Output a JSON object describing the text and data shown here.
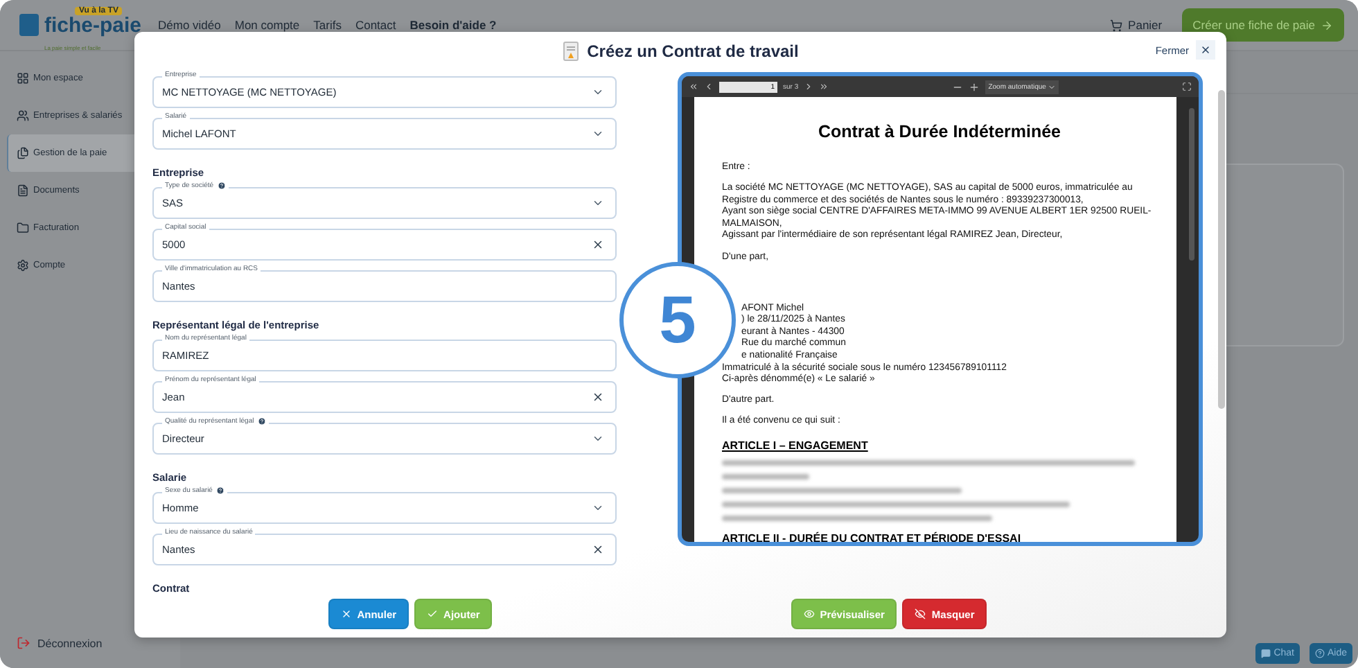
{
  "header": {
    "logo": "fiche-paie",
    "logo_badge": "Vu à la TV",
    "tagline": "La paie simple et facile",
    "nav": [
      {
        "label": "Démo vidéo",
        "bold": false
      },
      {
        "label": "Mon compte",
        "bold": false
      },
      {
        "label": "Tarifs",
        "bold": false
      },
      {
        "label": "Contact",
        "bold": false
      },
      {
        "label": "Besoin d'aide ?",
        "bold": true
      }
    ],
    "cart": "Panier",
    "cta": "Créer une fiche de paie"
  },
  "sidebar": {
    "items": [
      {
        "label": "Mon espace",
        "selected": false
      },
      {
        "label": "Entreprises & salariés",
        "selected": false
      },
      {
        "label": "Gestion de la paie",
        "selected": true
      },
      {
        "label": "Documents",
        "selected": false
      },
      {
        "label": "Facturation",
        "selected": false
      },
      {
        "label": "Compte",
        "selected": false
      }
    ],
    "logout": "Déconnexion"
  },
  "modal": {
    "title": "Créez un Contrat de travail",
    "close": "Fermer",
    "form": [
      {
        "kind": "select",
        "label": "Entreprise",
        "value": "MC NETTOYAGE (MC NETTOYAGE)",
        "help": false
      },
      {
        "kind": "select",
        "label": "Salarié",
        "value": "Michel LAFONT",
        "help": false
      },
      {
        "kind": "section",
        "title": "Entreprise"
      },
      {
        "kind": "select",
        "label": "Type de société",
        "value": "SAS",
        "help": true
      },
      {
        "kind": "clearable",
        "label": "Capital social",
        "value": "5000",
        "help": false
      },
      {
        "kind": "text",
        "label": "Ville d'immatriculation au RCS",
        "value": "Nantes",
        "help": false
      },
      {
        "kind": "section",
        "title": "Représentant légal de l'entreprise"
      },
      {
        "kind": "text",
        "label": "Nom du représentant légal",
        "value": "RAMIREZ",
        "help": false
      },
      {
        "kind": "clearable",
        "label": "Prénom du représentant légal",
        "value": "Jean",
        "help": false
      },
      {
        "kind": "select",
        "label": "Qualité du représentant légal",
        "value": "Directeur",
        "help": true
      },
      {
        "kind": "section",
        "title": "Salarie"
      },
      {
        "kind": "select",
        "label": "Sexe du salarié",
        "value": "Homme",
        "help": true
      },
      {
        "kind": "clearable",
        "label": "Lieu de naissance du salarié",
        "value": "Nantes",
        "help": false
      },
      {
        "kind": "section",
        "title": "Contrat"
      }
    ],
    "pdf": {
      "page": "1",
      "pages": "sur 3",
      "zoom": "Zoom automatique",
      "title": "Contrat à Durée Indéterminée",
      "blocks": [
        {
          "kind": "para",
          "lines": [
            "Entre :"
          ]
        },
        {
          "kind": "para",
          "lines": [
            "La société MC NETTOYAGE (MC NETTOYAGE), SAS au capital de 5000 euros, immatriculée au",
            "Registre du commerce et des sociétés de Nantes sous le numéro : 89339237300013,",
            "Ayant son siège social CENTRE D'AFFAIRES META-IMMO 99 AVENUE ALBERT 1ER 92500 RUEIL-",
            "MALMAISON,",
            "Agissant par l'intermédiaire de son représentant légal RAMIREZ Jean, Directeur,"
          ]
        },
        {
          "kind": "para",
          "lines": [
            "D'une part,"
          ]
        },
        {
          "kind": "covered",
          "lines": [
            "AFONT Michel",
            ") le 28/11/2025 à Nantes",
            "eurant à Nantes - 44300",
            "Rue du marché commun",
            "e nationalité Française"
          ]
        },
        {
          "kind": "tight",
          "lines": [
            "Immatriculé à la sécurité sociale sous le numéro 123456789101112",
            "Ci-après dénommé(e) « Le salarié »"
          ]
        },
        {
          "kind": "para",
          "lines": [
            "D'autre part."
          ]
        },
        {
          "kind": "para",
          "lines": [
            "Il a été convenu ce qui suit :"
          ]
        },
        {
          "kind": "heading",
          "lines": [
            "ARTICLE I – ENGAGEMENT"
          ]
        },
        {
          "kind": "blurred"
        },
        {
          "kind": "heading",
          "lines": [
            "ARTICLE II - DURÉE DU CONTRAT ET PÉRIODE D'ESSAI"
          ]
        }
      ]
    },
    "step_marker": "5",
    "buttons": [
      {
        "label": "Annuler",
        "kind": "cancel"
      },
      {
        "label": "Ajouter",
        "kind": "add"
      },
      {
        "label": "Prévisualiser",
        "kind": "preview"
      },
      {
        "label": "Masquer",
        "kind": "hide"
      }
    ]
  },
  "help_buttons": [
    {
      "label": "Chat",
      "kind": "chat"
    },
    {
      "label": "Aide",
      "kind": "help"
    }
  ]
}
